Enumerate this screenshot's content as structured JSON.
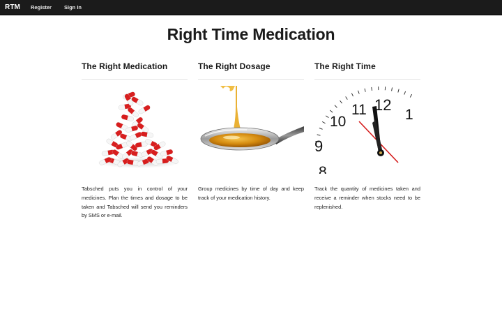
{
  "nav": {
    "brand": "RTM",
    "links": [
      "Register",
      "Sign In"
    ]
  },
  "page_title": "Right Time Medication",
  "features": [
    {
      "title": "The Right Medication",
      "image": "pills-image",
      "text": "Tabsched puts you in control of your medicines. Plan the times and dosage to be taken and Tabsched will send you reminders by SMS or e-mail."
    },
    {
      "title": "The Right Dosage",
      "image": "spoon-image",
      "text": "Group medicines by time of day and keep track of your medication history."
    },
    {
      "title": "The Right Time",
      "image": "clock-image",
      "text": "Track the quantity of medicines taken and receive a reminder when stocks need to be replenished."
    }
  ],
  "clock_numerals": [
    "11",
    "12",
    "1",
    "10",
    "9",
    "8"
  ],
  "colors": {
    "navbar": "#1b1b1b",
    "capsule_red": "#d81e1e",
    "honey": "#e0a21a"
  }
}
